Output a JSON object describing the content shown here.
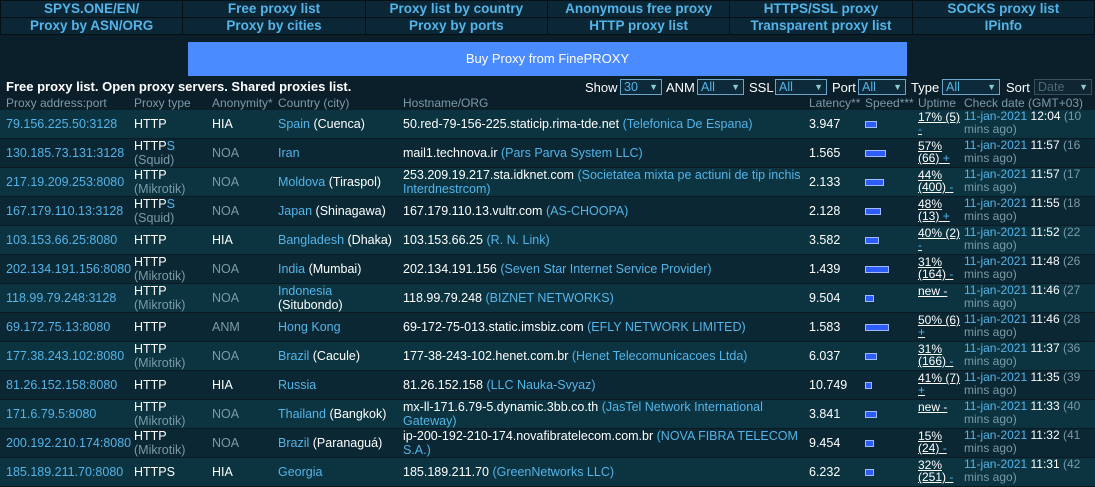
{
  "nav": {
    "row1": [
      "SPYS.ONE/EN/",
      "Free proxy list",
      "Proxy list by country",
      "Anonymous free proxy",
      "HTTPS/SSL proxy",
      "SOCKS proxy list"
    ],
    "row2": [
      "Proxy by ASN/ORG",
      "Proxy by cities",
      "Proxy by ports",
      "HTTP proxy list",
      "Transparent proxy list",
      "IPinfo"
    ]
  },
  "buy_label": "Buy Proxy from FinePROXY",
  "title": "Free proxy list. Open proxy servers. Shared proxies list.",
  "filters": {
    "show_label": "Show",
    "show_value": "30",
    "anm_label": "ANM",
    "anm_value": "All",
    "ssl_label": "SSL",
    "ssl_value": "All",
    "port_label": "Port",
    "port_value": "All",
    "type_label": "Type",
    "type_value": "All",
    "sort_label": "Sort",
    "sort_value": "Date"
  },
  "headers": [
    "Proxy address:port",
    "Proxy type",
    "Anonymity*",
    "Country (city)",
    "Hostname/ORG",
    "Latency**",
    "Speed***",
    "Uptime",
    "Check date (GMT+03)"
  ],
  "rows": [
    {
      "addr": "79.156.225.50:3128",
      "type": "HTTP",
      "sfx": "",
      "sub": "",
      "anon": "HIA",
      "country": "Spain",
      "city": "(Cuenca)",
      "host": "50.red-79-156-225.staticip.rima-tde.net",
      "org": "(Telefonica De Espana)",
      "latency": "3.947",
      "speed": 0.2,
      "uptime": "17% (5)",
      "uptime_plus": "-",
      "date": "11-jan-2021",
      "time": "12:04",
      "ago": "(10 mins ago)"
    },
    {
      "addr": "130.185.73.131:3128",
      "type": "HTTP",
      "sfx": "S",
      "sub": "(Squid)",
      "anon": "NOA",
      "country": "Iran",
      "city": "",
      "host": "mail1.technova.ir",
      "org": "(Pars Parva System LLC)",
      "latency": "1.565",
      "speed": 0.4,
      "uptime": "57% (66)",
      "uptime_plus": "+",
      "date": "11-jan-2021",
      "time": "11:57",
      "ago": "(16 mins ago)"
    },
    {
      "addr": "217.19.209.253:8080",
      "type": "HTTP",
      "sfx": "",
      "sub": "(Mikrotik)",
      "anon": "NOA",
      "country": "Moldova",
      "city": "(Tiraspol)",
      "host": "253.209.19.217.sta.idknet.com",
      "org": "(Societatea mixta pe actiuni de tip inchis Interdnestrcom)",
      "latency": "2.133",
      "speed": 0.35,
      "uptime": "44% (400)",
      "uptime_plus": "-",
      "date": "11-jan-2021",
      "time": "11:57",
      "ago": "(17 mins ago)"
    },
    {
      "addr": "167.179.110.13:3128",
      "type": "HTTP",
      "sfx": "S",
      "sub": "(Squid)",
      "anon": "NOA",
      "country": "Japan",
      "city": "(Shinagawa)",
      "host": "167.179.110.13.vultr.com",
      "org": "(AS-CHOOPA)",
      "latency": "2.128",
      "speed": 0.3,
      "uptime": "48% (13)",
      "uptime_plus": "+",
      "date": "11-jan-2021",
      "time": "11:55",
      "ago": "(18 mins ago)"
    },
    {
      "addr": "103.153.66.25:8080",
      "type": "HTTP",
      "sfx": "",
      "sub": "",
      "anon": "HIA",
      "country": "Bangladesh",
      "city": "(Dhaka)",
      "host": "103.153.66.25",
      "org": "(R. N. Link)",
      "latency": "3.582",
      "speed": 0.25,
      "uptime": "40% (2)",
      "uptime_plus": "-",
      "date": "11-jan-2021",
      "time": "11:52",
      "ago": "(22 mins ago)"
    },
    {
      "addr": "202.134.191.156:8080",
      "type": "HTTP",
      "sfx": "",
      "sub": "(Mikrotik)",
      "anon": "NOA",
      "country": "India",
      "city": "(Mumbai)",
      "host": "202.134.191.156",
      "org": "(Seven Star Internet Service Provider)",
      "latency": "1.439",
      "speed": 0.45,
      "uptime": "31% (164)",
      "uptime_plus": "-",
      "date": "11-jan-2021",
      "time": "11:48",
      "ago": "(26 mins ago)"
    },
    {
      "addr": "118.99.79.248:3128",
      "type": "HTTP",
      "sfx": "",
      "sub": "(Mikrotik)",
      "anon": "NOA",
      "country": "Indonesia",
      "city": "(Situbondo)",
      "host": "118.99.79.248",
      "org": "(BIZNET NETWORKS)",
      "latency": "9.504",
      "speed": 0.15,
      "uptime": "new -",
      "uptime_plus": "",
      "date": "11-jan-2021",
      "time": "11:46",
      "ago": "(27 mins ago)"
    },
    {
      "addr": "69.172.75.13:8080",
      "type": "HTTP",
      "sfx": "",
      "sub": "",
      "anon": "ANM",
      "country": "Hong Kong",
      "city": "",
      "host": "69-172-75-013.static.imsbiz.com",
      "org": "(EFLY NETWORK LIMITED)",
      "latency": "1.583",
      "speed": 0.45,
      "uptime": "50% (6)",
      "uptime_plus": "+",
      "date": "11-jan-2021",
      "time": "11:46",
      "ago": "(28 mins ago)"
    },
    {
      "addr": "177.38.243.102:8080",
      "type": "HTTP",
      "sfx": "",
      "sub": "(Mikrotik)",
      "anon": "NOA",
      "country": "Brazil",
      "city": "(Cacule)",
      "host": "177-38-243-102.henet.com.br",
      "org": "(Henet Telecomunicacoes Ltda)",
      "latency": "6.037",
      "speed": 0.2,
      "uptime": "31% (166)",
      "uptime_plus": "-",
      "date": "11-jan-2021",
      "time": "11:37",
      "ago": "(36 mins ago)"
    },
    {
      "addr": "81.26.152.158:8080",
      "type": "HTTP",
      "sfx": "",
      "sub": "",
      "anon": "HIA",
      "country": "Russia",
      "city": "",
      "host": "81.26.152.158",
      "org": "(LLC Nauka-Svyaz)",
      "latency": "10.749",
      "speed": 0.1,
      "uptime": "41% (7)",
      "uptime_plus": "+",
      "date": "11-jan-2021",
      "time": "11:35",
      "ago": "(39 mins ago)"
    },
    {
      "addr": "171.6.79.5:8080",
      "type": "HTTP",
      "sfx": "",
      "sub": "(Mikrotik)",
      "anon": "NOA",
      "country": "Thailand",
      "city": "(Bangkok)",
      "host": "mx-ll-171.6.79-5.dynamic.3bb.co.th",
      "org": "(JasTel Network International Gateway)",
      "latency": "3.841",
      "speed": 0.2,
      "uptime": "new -",
      "uptime_plus": "",
      "date": "11-jan-2021",
      "time": "11:33",
      "ago": "(40 mins ago)"
    },
    {
      "addr": "200.192.210.174:8080",
      "type": "HTTP",
      "sfx": "",
      "sub": "(Mikrotik)",
      "anon": "NOA",
      "country": "Brazil",
      "city": "(Paranaguá)",
      "host": "ip-200-192-210-174.novafibratelecom.com.br",
      "org": "(NOVA FIBRA TELECOM S.A.)",
      "latency": "9.454",
      "speed": 0.15,
      "uptime": "15% (24)",
      "uptime_plus": "-",
      "date": "11-jan-2021",
      "time": "11:32",
      "ago": "(41 mins ago)"
    },
    {
      "addr": "185.189.211.70:8080",
      "type": "HTTPS",
      "sfx": "",
      "sub": "",
      "anon": "HIA",
      "country": "Georgia",
      "city": "",
      "host": "185.189.211.70",
      "org": "(GreenNetworks LLC)",
      "latency": "6.232",
      "speed": 0.15,
      "uptime": "32% (251)",
      "uptime_plus": "-",
      "date": "11-jan-2021",
      "time": "11:31",
      "ago": "(42 mins ago)"
    }
  ]
}
